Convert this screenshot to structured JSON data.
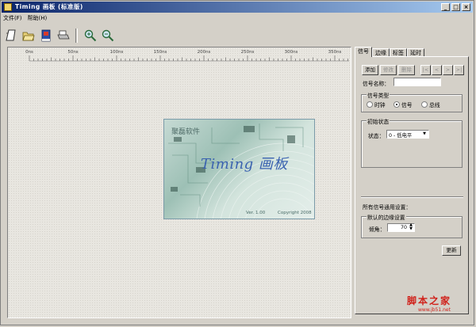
{
  "window": {
    "title": "Timing 画板  (标准版)",
    "controls": [
      "_",
      "□",
      "×"
    ]
  },
  "menu": [
    {
      "label": "文件",
      "hotkey": "(F)"
    },
    {
      "label": "帮助",
      "hotkey": "(H)"
    }
  ],
  "toolbar": {
    "icons": [
      "new-file-icon",
      "open-folder-icon",
      "save-book-icon",
      "print-icon",
      "zoom-in-icon",
      "zoom-out-icon"
    ]
  },
  "ruler": {
    "labels": [
      "0ns",
      "50ns",
      "100ns",
      "150ns",
      "200ns",
      "250ns",
      "300ns",
      "350ns"
    ]
  },
  "splash": {
    "company": "聚磊软件",
    "product": "Timing 画板",
    "version": "Ver. 1.00",
    "copyright": "Copyright 2008"
  },
  "panel": {
    "tabs": [
      "信号",
      "边缘",
      "标签",
      "延时"
    ],
    "actions": {
      "add": "添加",
      "modify": "修改",
      "delete": "删除"
    },
    "nav": [
      "|<",
      "<",
      ">",
      ">|"
    ],
    "signal_name_label": "信号名称：",
    "signal_name_value": "",
    "signal_type": {
      "title": "信号类型",
      "options": [
        "时钟",
        "信号",
        "总线"
      ],
      "selected": "信号"
    },
    "initial_state": {
      "title": "初始状态",
      "state_label": "状态：",
      "state_value": "0 - 低电平"
    },
    "common_settings_label": "所有信号通用设置：",
    "default_edge": {
      "title": "默认的边缘设置",
      "slope_label": "倾角：",
      "slope_value": "70"
    },
    "update_button": "更新"
  },
  "watermark": {
    "logo": "脚本之家",
    "url": "www.jb51.net"
  }
}
